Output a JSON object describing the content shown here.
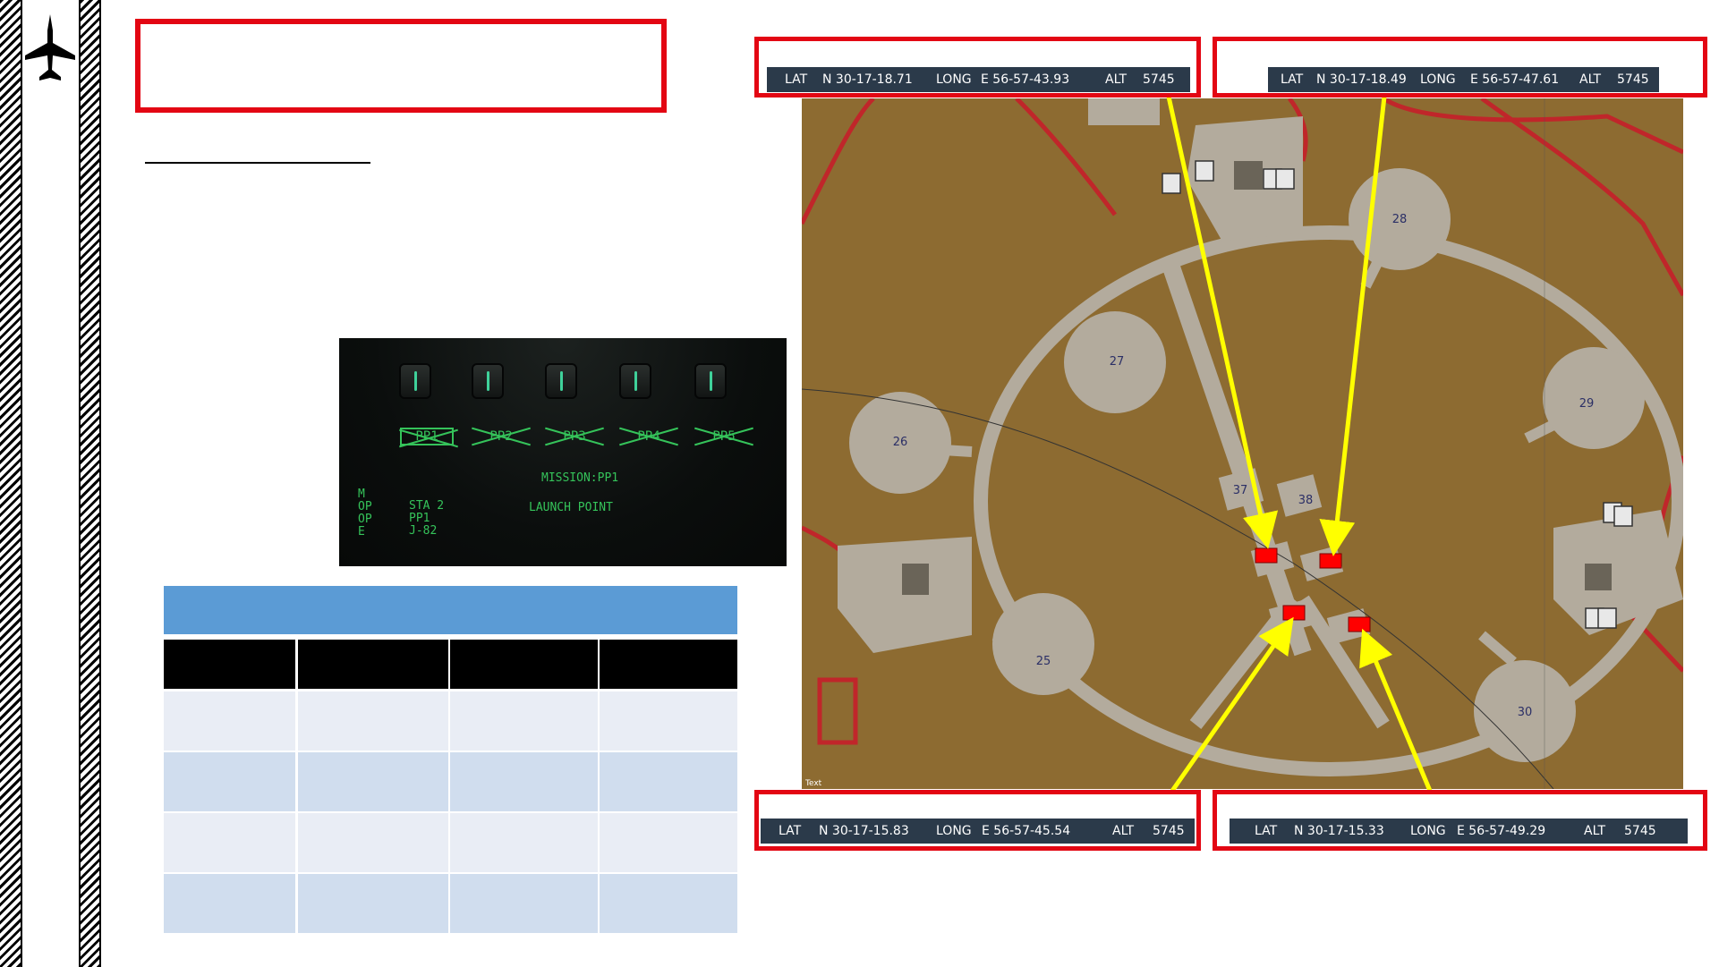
{
  "ufc": {
    "options": [
      "PP1",
      "PP2",
      "PP3",
      "PP4",
      "PP5"
    ],
    "mission": "MISSION:PP1",
    "left_text": "M\nOP\nOP\nE",
    "sta_text": "STA 2\nPP1\nJ-82",
    "launch": "LAUNCH POINT"
  },
  "coords": [
    {
      "lat_label": "LAT",
      "lat": "N 30-17-18.71",
      "long_label": "LONG",
      "long": "E 56-57-43.93",
      "alt_label": "ALT",
      "alt": "5745"
    },
    {
      "lat_label": "LAT",
      "lat": "N 30-17-18.49",
      "long_label": "LONG",
      "long": "E 56-57-47.61",
      "alt_label": "ALT",
      "alt": "5745"
    },
    {
      "lat_label": "LAT",
      "lat": "N 30-17-15.83",
      "long_label": "LONG",
      "long": "E 56-57-45.54",
      "alt_label": "ALT",
      "alt": "5745"
    },
    {
      "lat_label": "LAT",
      "lat": "N 30-17-15.33",
      "long_label": "LONG",
      "long": "E 56-57-49.29",
      "alt_label": "ALT",
      "alt": "5745"
    }
  ],
  "map": {
    "pad_labels": [
      "25",
      "26",
      "27",
      "28",
      "29",
      "30",
      "37",
      "38"
    ],
    "scale_label": "Text"
  },
  "colors": {
    "frame_red": "#e30613",
    "arrow_yellow": "#ffff00",
    "table_header_blue": "#5b9bd5",
    "map_ground": "#8d6b31",
    "taxiway": "#b3ab9d"
  }
}
